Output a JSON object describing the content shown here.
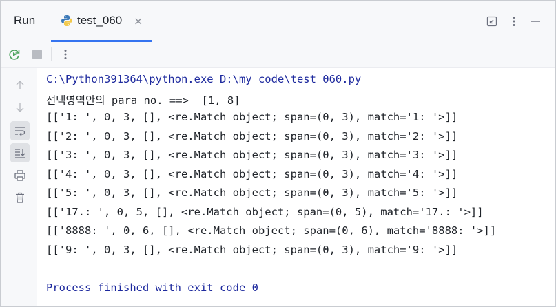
{
  "panel": {
    "title": "Run",
    "tab_label": "test_060",
    "tab_close": "×"
  },
  "icons": {
    "tab": "python-icon",
    "header": [
      "restore-window-icon",
      "more-vertical-icon",
      "minimize-icon"
    ],
    "toolbar": [
      "rerun-icon",
      "stop-icon",
      "more-vertical-icon"
    ],
    "gutter": [
      "arrow-up-icon",
      "arrow-down-icon",
      "soft-wrap-icon",
      "scroll-to-end-icon",
      "print-icon",
      "trash-icon"
    ]
  },
  "colors": {
    "accent": "#3574f0",
    "command_text": "#1e2a9e",
    "rerun_green": "#4ba35c",
    "stop_gray": "#b9bcc2"
  },
  "console": {
    "command": "C:\\Python391364\\python.exe D:\\my_code\\test_060.py",
    "lines": [
      "선택영역안의 para no. ==>  [1, 8]",
      "[['1: ', 0, 3, [], <re.Match object; span=(0, 3), match='1: '>]]",
      "[['2: ', 0, 3, [], <re.Match object; span=(0, 3), match='2: '>]]",
      "[['3: ', 0, 3, [], <re.Match object; span=(0, 3), match='3: '>]]",
      "[['4: ', 0, 3, [], <re.Match object; span=(0, 3), match='4: '>]]",
      "[['5: ', 0, 3, [], <re.Match object; span=(0, 3), match='5: '>]]",
      "[['17.: ', 0, 5, [], <re.Match object; span=(0, 5), match='17.: '>]]",
      "[['8888: ', 0, 6, [], <re.Match object; span=(0, 6), match='8888: '>]]",
      "[['9: ', 0, 3, [], <re.Match object; span=(0, 3), match='9: '>]]"
    ],
    "exit_message": "Process finished with exit code 0"
  }
}
